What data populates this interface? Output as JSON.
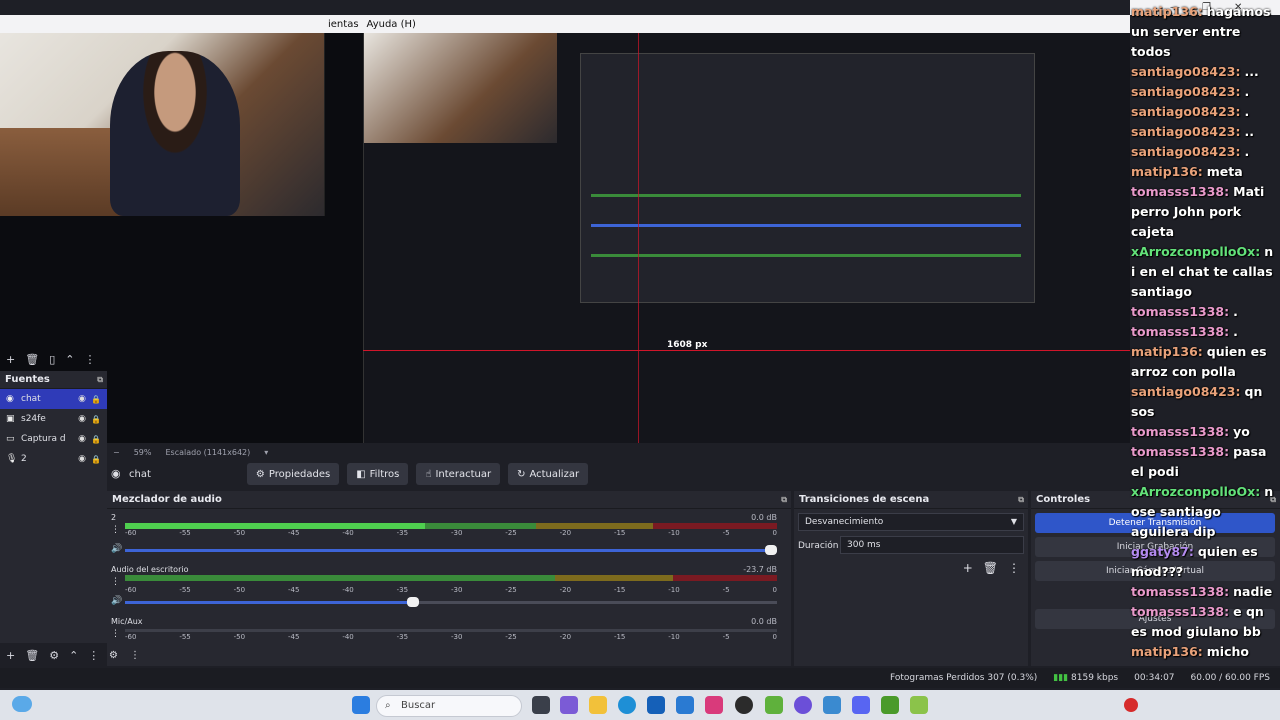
{
  "menu": {
    "item1": "ientas",
    "item2": "Ayuda (H)"
  },
  "preview": {
    "px_label": "1608 px"
  },
  "zoombar": {
    "zoom": "59%",
    "scale": "Escalado (1141x642)"
  },
  "sources": {
    "title": "Fuentes",
    "items": [
      {
        "label": "chat",
        "icon": "globe-icon",
        "selected": true
      },
      {
        "label": "s24fe",
        "icon": "camera-icon",
        "selected": false
      },
      {
        "label": "Captura d",
        "icon": "monitor-icon",
        "selected": false
      },
      {
        "label": "2",
        "icon": "microphone-icon",
        "selected": false
      }
    ]
  },
  "source_toolbar": {
    "name": "chat",
    "properties": "Propiedades",
    "filters": "Filtros",
    "interact": "Interactuar",
    "refresh": "Actualizar"
  },
  "mixer": {
    "title": "Mezclador de audio",
    "scale": [
      "-60",
      "-55",
      "-50",
      "-45",
      "-40",
      "-35",
      "-30",
      "-25",
      "-20",
      "-15",
      "-10",
      "-5",
      "0"
    ],
    "tracks": [
      {
        "name": "2",
        "db": "0.0 dB",
        "level": 0.46,
        "volume": 1.0
      },
      {
        "name": "Audio del escritorio",
        "db": "-23.7 dB",
        "level": 0.0,
        "volume": 0.44
      },
      {
        "name": "Mic/Aux",
        "db": "0.0 dB",
        "level": 0.0,
        "volume": null
      }
    ]
  },
  "transitions": {
    "title": "Transiciones de escena",
    "selected": "Desvanecimiento",
    "duration_label": "Duración",
    "duration_value": "300 ms"
  },
  "controls": {
    "title": "Controles",
    "stop_stream": "Detener Transmisión",
    "start_record": "Iniciar Grabación",
    "start_virtual": "Iniciar Cámara Virtual",
    "settings": "Ajustes"
  },
  "status": {
    "dropped": "Fotogramas Perdidos 307 (0.3%)",
    "bitrate": "8159 kbps",
    "time": "00:34:07",
    "fps": "60.00 / 60.00 FPS"
  },
  "chat": {
    "colors": {
      "matip136": "#e9a27a",
      "santiago08423": "#e9a27a",
      "tomasss1338": "#e99acb",
      "xArrozconpolloOx": "#63e27a",
      "ggaty87": "#b48bf0"
    },
    "messages": [
      {
        "user": "matip136",
        "text": "hagamos un server entre todos"
      },
      {
        "user": "santiago08423",
        "text": "..."
      },
      {
        "user": "santiago08423",
        "text": "."
      },
      {
        "user": "santiago08423",
        "text": "."
      },
      {
        "user": "santiago08423",
        "text": ".."
      },
      {
        "user": "santiago08423",
        "text": "."
      },
      {
        "user": "matip136",
        "text": "meta"
      },
      {
        "user": "tomasss1338",
        "text": "Mati perro John pork cajeta"
      },
      {
        "user": "xArrozconpolloOx",
        "text": "ni en el chat te callas santiago"
      },
      {
        "user": "tomasss1338",
        "text": "."
      },
      {
        "user": "tomasss1338",
        "text": "."
      },
      {
        "user": "matip136",
        "text": "quien es arroz con polla"
      },
      {
        "user": "santiago08423",
        "text": "qn sos"
      },
      {
        "user": "tomasss1338",
        "text": "yo"
      },
      {
        "user": "tomasss1338",
        "text": "pasa el podi"
      },
      {
        "user": "xArrozconpolloOx",
        "text": "nose santiago aguilera dip"
      },
      {
        "user": "ggaty87",
        "text": "quien es mod???"
      },
      {
        "user": "tomasss1338",
        "text": "nadie"
      },
      {
        "user": "tomasss1338",
        "text": "e qn es mod giulano bb"
      },
      {
        "user": "matip136",
        "text": "micho"
      }
    ]
  },
  "taskbar": {
    "search_placeholder": "Buscar"
  }
}
